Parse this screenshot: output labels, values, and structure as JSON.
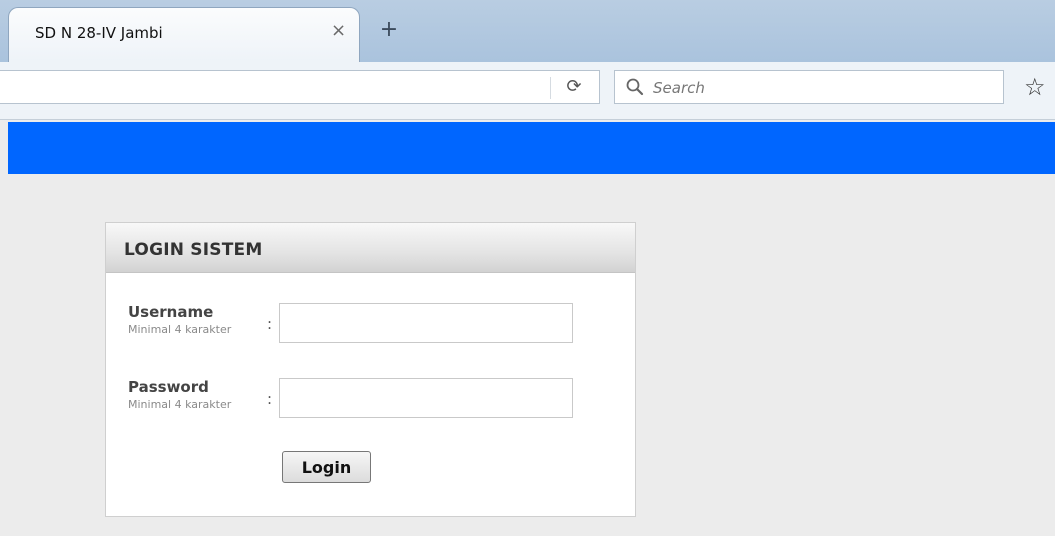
{
  "browser": {
    "tab_title": "SD N 28-IV Jambi",
    "tab_close_glyph": "×",
    "new_tab_glyph": "+",
    "url_value": "",
    "reload_glyph": "⟳",
    "search_placeholder": "Search",
    "bookmark_glyph": "☆",
    "icons": [
      "close-icon",
      "plus-icon",
      "reload-icon",
      "search-icon",
      "star-icon"
    ]
  },
  "colors": {
    "banner": "#0066ff",
    "page_background": "#ececec"
  },
  "login": {
    "title": "LOGIN SISTEM",
    "username_label": "Username",
    "username_hint": "Minimal 4 karakter",
    "username_value": "",
    "password_label": "Password",
    "password_hint": "Minimal 4 karakter",
    "password_value": "",
    "colon": ":",
    "button_label": "Login"
  }
}
